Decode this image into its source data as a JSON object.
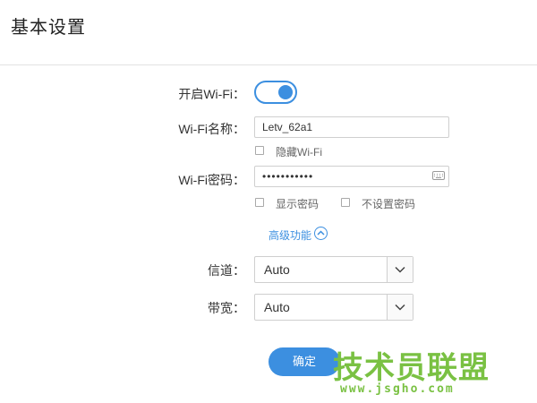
{
  "header": {
    "title": "基本设置"
  },
  "wifi": {
    "enable_label": "开启Wi-Fi：",
    "enabled": true,
    "name_label": "Wi-Fi名称：",
    "name_value": "Letv_62a1",
    "hide_label": "隐藏Wi-Fi",
    "hide_checked": false,
    "password_label": "Wi-Fi密码：",
    "password_masked": "•••••••••••",
    "show_password_label": "显示密码",
    "show_password_checked": false,
    "no_password_label": "不设置密码",
    "no_password_checked": false
  },
  "advanced": {
    "label": "高级功能"
  },
  "channel": {
    "label": "信道：",
    "value": "Auto"
  },
  "bandwidth": {
    "label": "带宽：",
    "value": "Auto"
  },
  "actions": {
    "confirm_label": "确定"
  },
  "watermark": {
    "text": "技术员联盟",
    "url": "www.jsgho.com"
  },
  "colors": {
    "accent": "#3c8fe0",
    "watermark": "#7ac143"
  }
}
